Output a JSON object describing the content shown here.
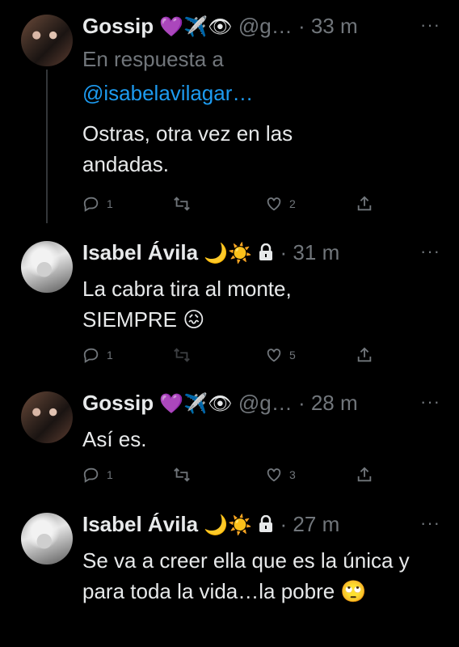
{
  "tweets": [
    {
      "name": "Gossip",
      "name_emojis": "💜✈️👁",
      "handle": "@g…",
      "time": "· 33 m",
      "more": "···",
      "reply_label": "En respuesta a",
      "reply_mention": "@isabelavilagar…",
      "text": "Ostras, otra vez en las andadas.",
      "replies": "1",
      "retweets": "",
      "likes": "2"
    },
    {
      "name": "Isabel Ávila",
      "name_emojis": "🌙☀️",
      "lock_icon": "lock-icon",
      "time": "· 31 m",
      "more": "···",
      "text": "La cabra tira al monte, SIEMPRE 😖",
      "replies": "1",
      "retweets": "",
      "likes": "5"
    },
    {
      "name": "Gossip",
      "name_emojis": "💜✈️👁",
      "handle": "@g…",
      "time": "· 28 m",
      "more": "···",
      "text": "Así es.",
      "replies": "1",
      "retweets": "",
      "likes": "3"
    },
    {
      "name": "Isabel Ávila",
      "name_emojis": "🌙☀️",
      "lock_icon": "lock-icon",
      "time": "· 27 m",
      "more": "···",
      "text": "Se va a creer ella que es la única y para toda la vida…la pobre 🙄"
    }
  ],
  "colors": {
    "background": "#000000",
    "text": "#e7e9ea",
    "muted": "#71767b",
    "link": "#1d9bf0",
    "thread_line": "#333639"
  }
}
